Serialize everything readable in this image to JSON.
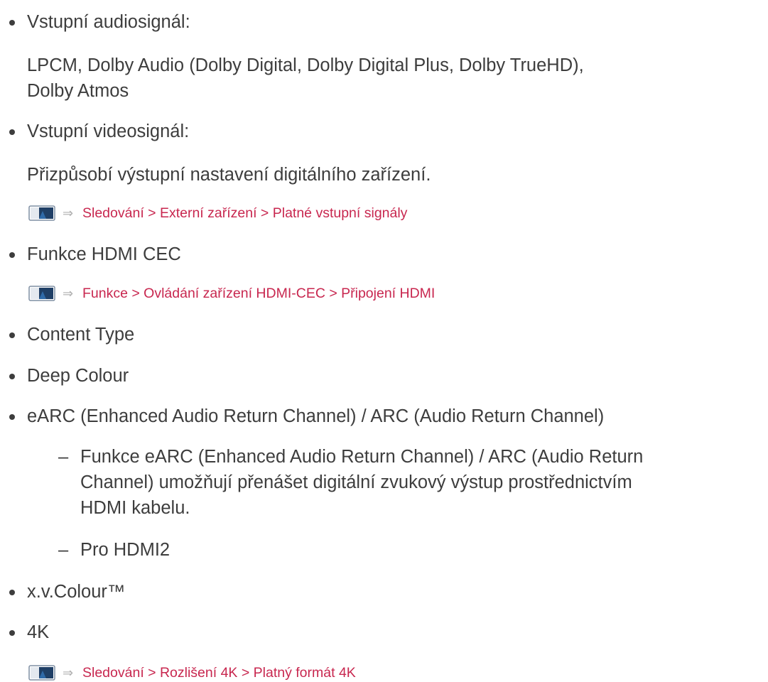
{
  "items": {
    "audio_label": "Vstupní audiosignál:",
    "audio_line1": "LPCM, Dolby Audio (Dolby Digital, Dolby Digital Plus, Dolby TrueHD),",
    "audio_line2": "Dolby Atmos",
    "video_label": "Vstupní videosignál:",
    "video_desc": "Přizpůsobí výstupní nastavení digitálního zařízení.",
    "link1": "Sledování > Externí zařízení > Platné vstupní signály",
    "cec": "Funkce HDMI CEC",
    "link2": "Funkce > Ovládání zařízení HDMI-CEC > Připojení HDMI",
    "content_type": "Content Type",
    "deep_colour": "Deep Colour",
    "earc": "eARC (Enhanced Audio Return Channel) / ARC (Audio Return Channel)",
    "earc_sub1_line1": "Funkce eARC (Enhanced Audio Return Channel) / ARC (Audio Return",
    "earc_sub1_line2": "Channel) umožňují přenášet digitální zvukový výstup prostřednictvím",
    "earc_sub1_line3": "HDMI kabelu.",
    "earc_sub2": "Pro HDMI2",
    "xvcolour": "x.v.Colour™",
    "fourk": "4K",
    "link3": "Sledování > Rozlišení 4K > Platný formát 4K"
  },
  "symbols": {
    "bullet": "•",
    "dash": "–",
    "arrow": "⇒"
  },
  "icons": {
    "reference": "tv-screen-icon",
    "arrow": "arrow-right-icon"
  },
  "colors": {
    "text": "#3d3d3d",
    "link": "#c8274f"
  }
}
